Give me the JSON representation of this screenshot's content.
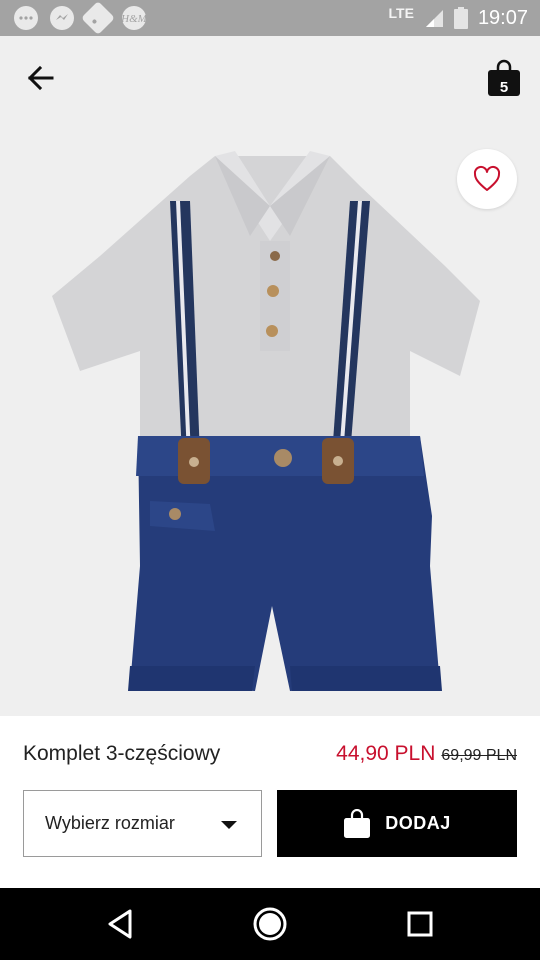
{
  "status_bar": {
    "network": "LTE",
    "time": "19:07",
    "notification_icons": [
      "chat-bubble-icon",
      "messenger-icon",
      "tag-icon",
      "hm-app-icon"
    ]
  },
  "header": {
    "cart_count": "5"
  },
  "product": {
    "name": "Komplet 3-częściowy",
    "price_sale": "44,90 PLN",
    "price_original": "69,99 PLN",
    "sale_color": "#c8102e"
  },
  "actions": {
    "size_select_label": "Wybierz rozmiar",
    "add_label": "DODAJ"
  }
}
